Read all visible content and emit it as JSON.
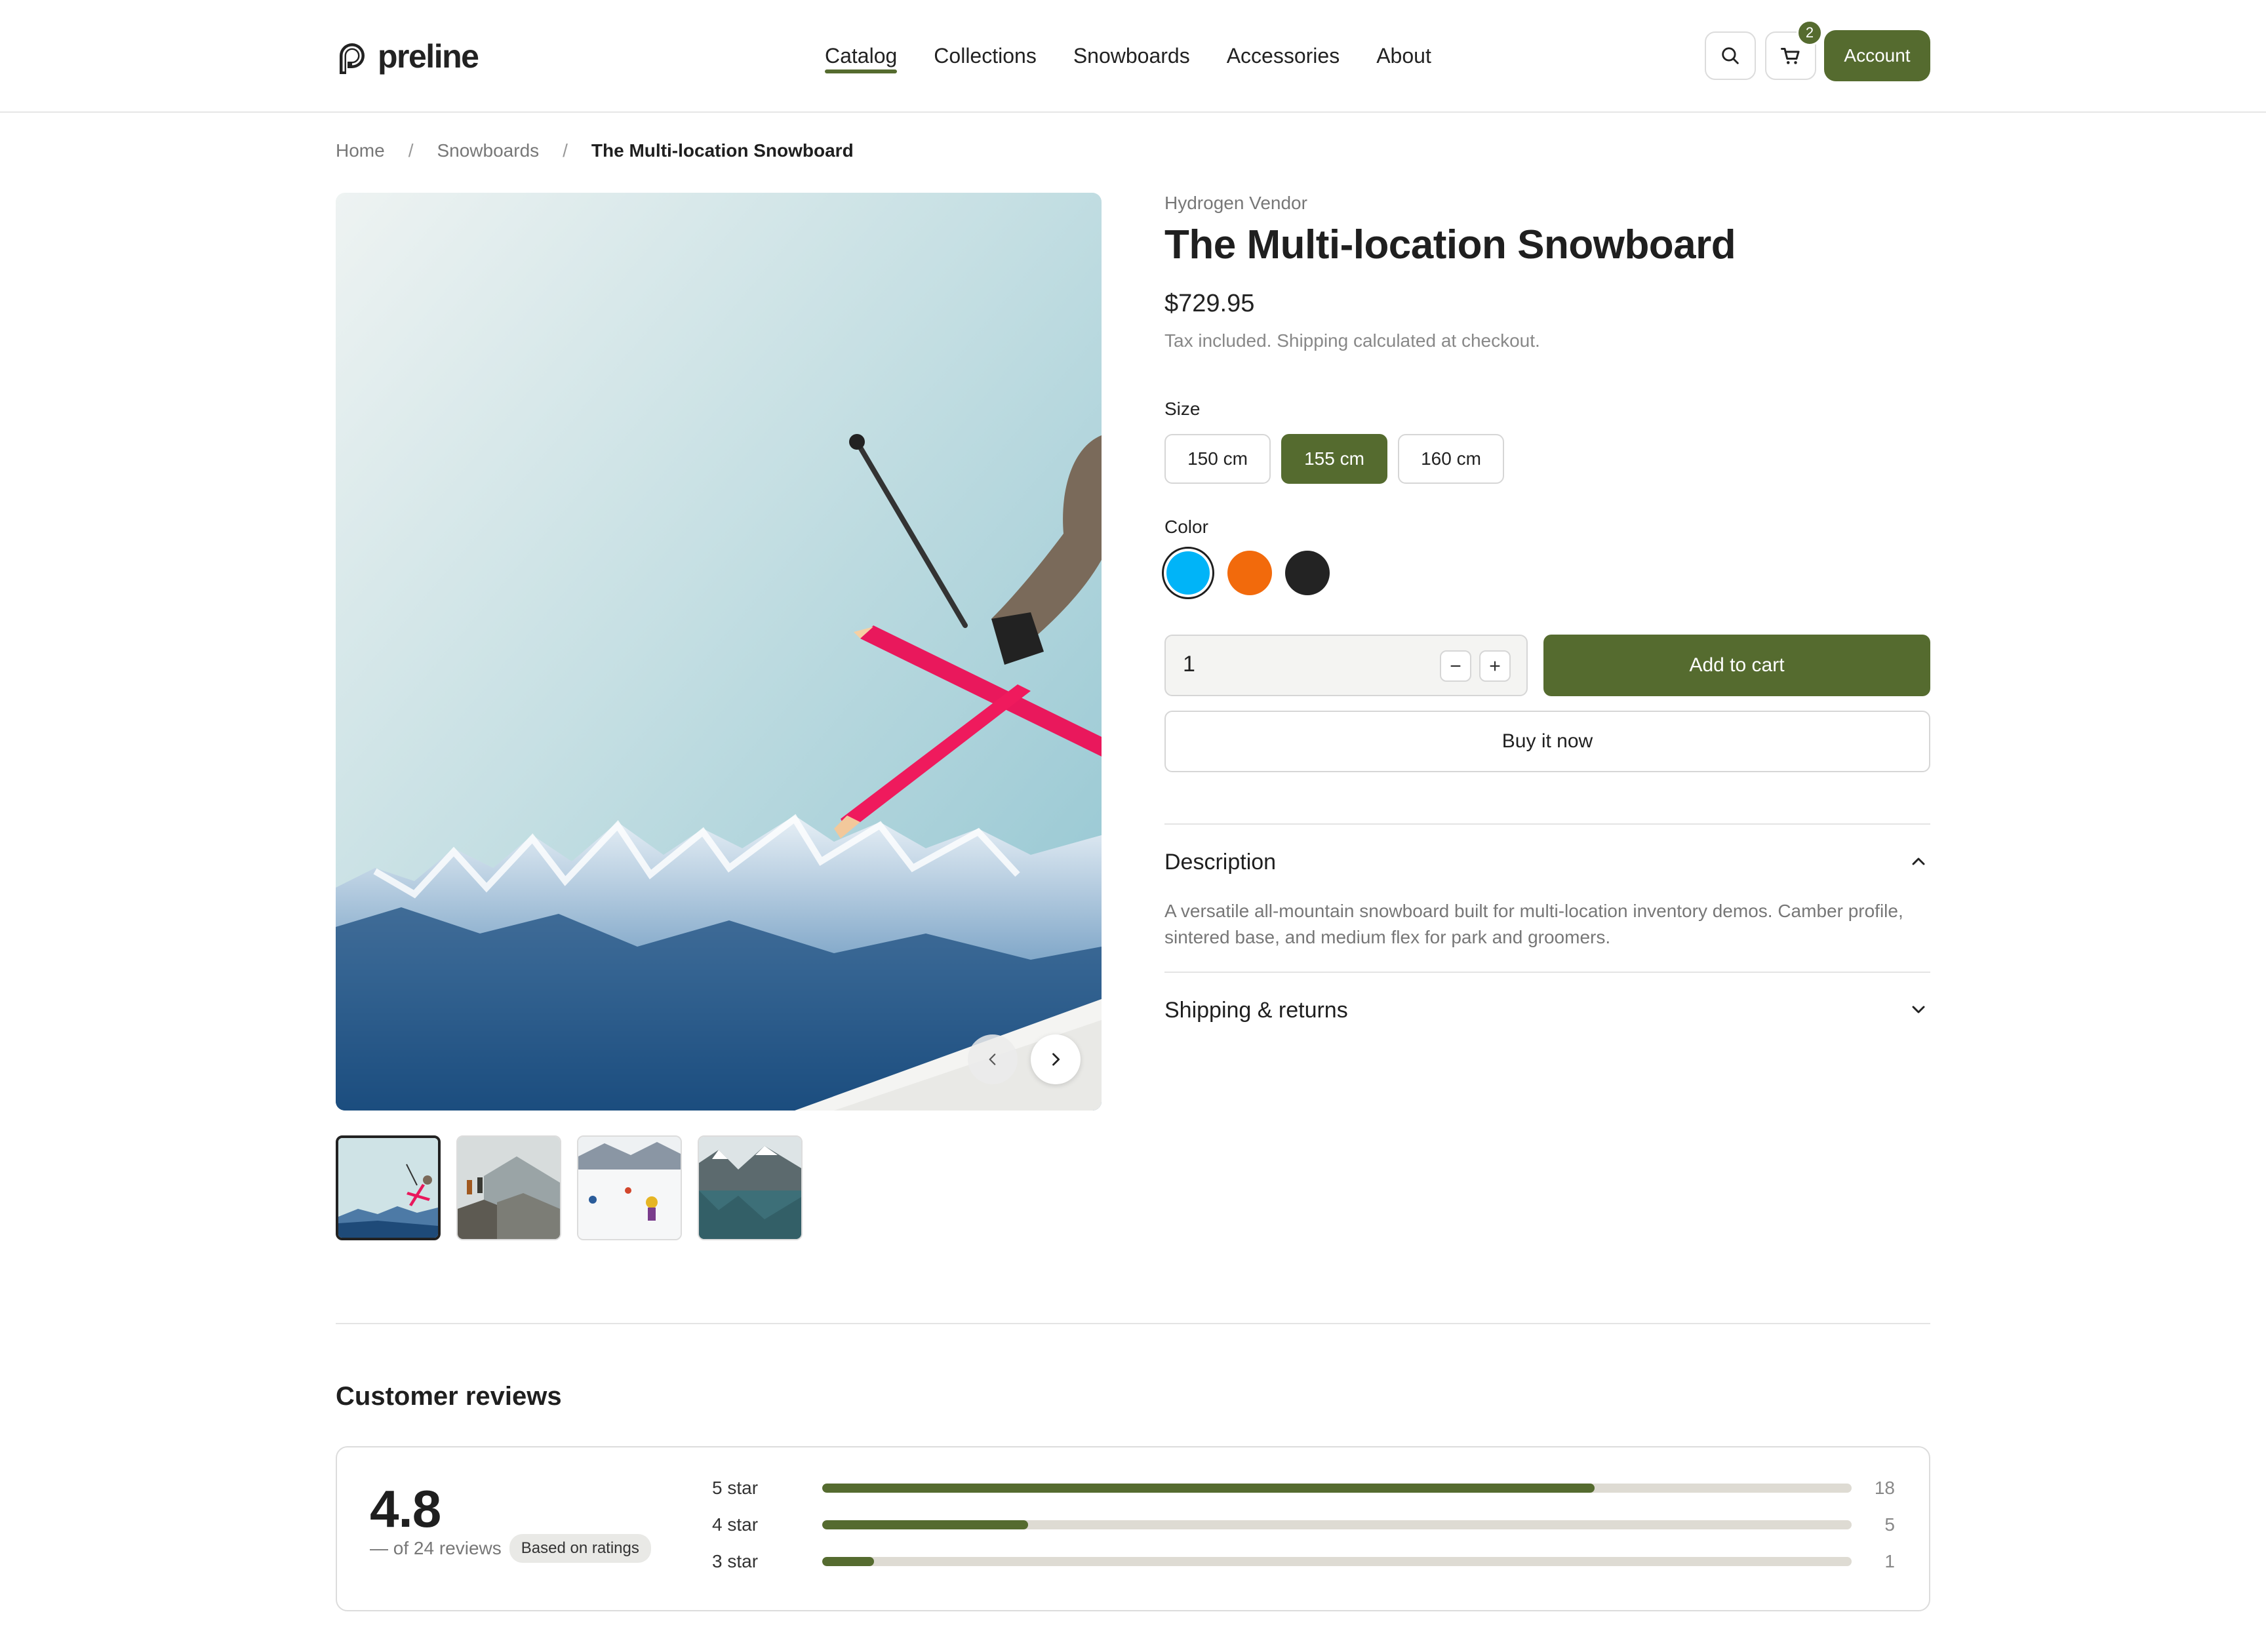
{
  "header": {
    "logo_text": "preline",
    "nav": [
      "Catalog",
      "Collections",
      "Snowboards",
      "Accessories",
      "About"
    ],
    "active_nav": "Catalog",
    "cart_count": "2",
    "account_label": "Account",
    "icons": {
      "search": "search-icon",
      "cart": "cart-icon"
    }
  },
  "breadcrumb": [
    "Home",
    "Snowboards",
    "The Multi-location Snowboard"
  ],
  "product": {
    "vendor": "Hydrogen Vendor",
    "title": "The Multi-location Snowboard",
    "price": "$729.95",
    "tax_note": "Tax included. Shipping calculated at checkout.",
    "size_label": "Size",
    "sizes": [
      "150 cm",
      "155 cm",
      "160 cm"
    ],
    "selected_size": "155 cm",
    "color_label": "Color",
    "colors": [
      "#00b4f8",
      "#f26a0c",
      "#232323"
    ],
    "selected_color": "#00b4f8",
    "quantity": "1",
    "add_to_cart_label": "Add to cart",
    "buy_now_label": "Buy it now"
  },
  "gallery": {
    "thumbnails": [
      "skier-jump",
      "hikers-mountain",
      "skiers-slope",
      "mountain-lake"
    ],
    "selected_thumbnail": "skier-jump"
  },
  "accordion": {
    "description_title": "Description",
    "description_body": "A versatile all-mountain snowboard built for multi-location inventory demos. Camber profile, sintered base, and medium flex for park and groomers.",
    "description_expanded": true,
    "shipping_title": "Shipping & returns",
    "shipping_expanded": false
  },
  "reviews": {
    "title": "Customer reviews",
    "average": "4.8",
    "total_text": "— of 24 reviews",
    "badge": "Based on ratings",
    "breakdown": [
      {
        "label": "5 star",
        "count": "18",
        "fraction": 0.75
      },
      {
        "label": "4 star",
        "count": "5",
        "fraction": 0.2
      },
      {
        "label": "3 star",
        "count": "1",
        "fraction": 0.05
      }
    ]
  },
  "theme": {
    "accent": "#556b2f"
  }
}
